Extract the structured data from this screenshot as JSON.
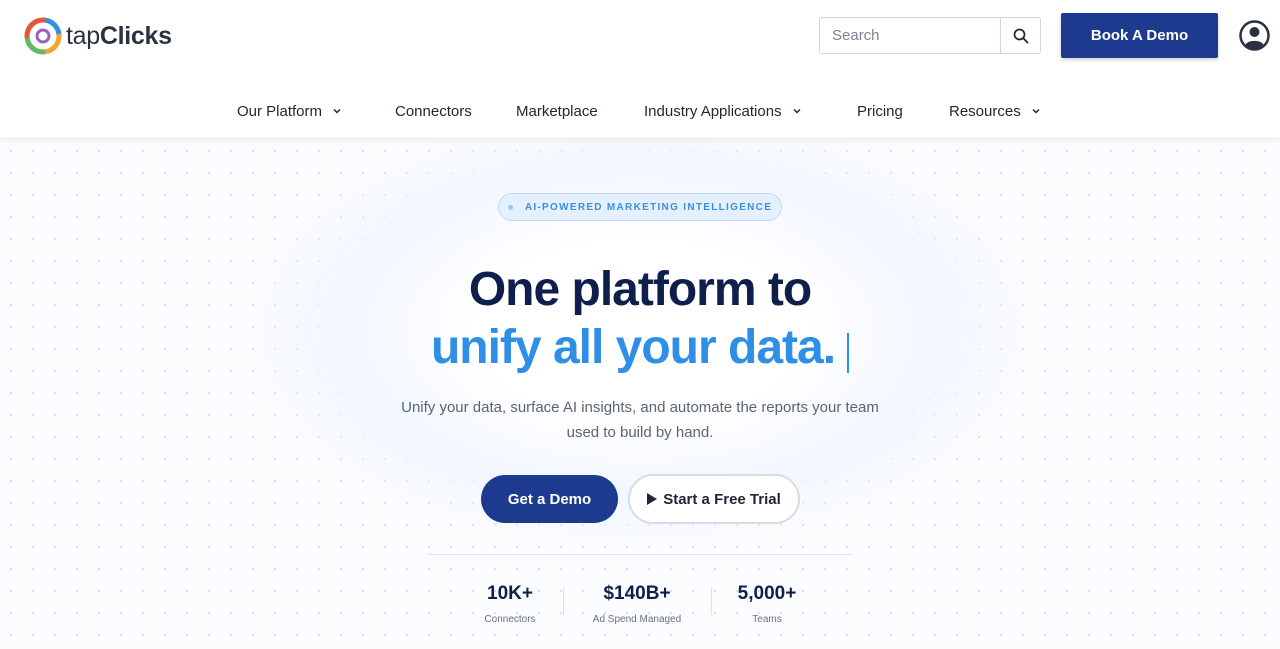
{
  "header": {
    "logo": {
      "text_light": "tap",
      "text_bold": "Clicks",
      "icon": "tapclicks-ring-logo"
    },
    "search": {
      "placeholder": "Search",
      "icon": "search-icon"
    },
    "book_demo_label": "Book A Demo",
    "account_icon": "user-account-icon"
  },
  "nav": {
    "items": [
      {
        "label": "Our Platform",
        "has_dropdown": true
      },
      {
        "label": "Connectors",
        "has_dropdown": false
      },
      {
        "label": "Marketplace",
        "has_dropdown": false
      },
      {
        "label": "Industry Applications",
        "has_dropdown": true
      },
      {
        "label": "Pricing",
        "has_dropdown": false
      },
      {
        "label": "Resources",
        "has_dropdown": true
      }
    ]
  },
  "hero": {
    "badge": "AI-POWERED MARKETING INTELLIGENCE",
    "headline_line1": "One platform to",
    "headline_line2": "unify all your data.",
    "subtext": "Unify your data, surface AI insights, and automate the reports your team used to build by hand.",
    "primary_cta": "Get a Demo",
    "secondary_cta": "Start a Free Trial",
    "stats": [
      {
        "value": "10K+",
        "label": "Connectors"
      },
      {
        "value": "$140B+",
        "label": "Ad Spend Managed"
      },
      {
        "value": "5,000+",
        "label": "Teams"
      }
    ]
  },
  "colors": {
    "brand_navy": "#1c3a8e",
    "headline_dark": "#0f1f4b",
    "accent_blue": "#2f8ee6"
  }
}
